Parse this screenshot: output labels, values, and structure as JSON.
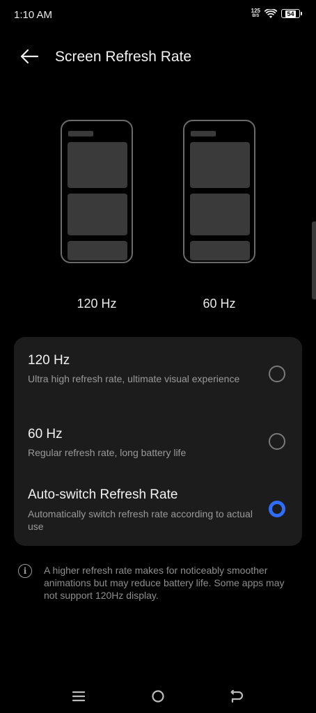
{
  "status_bar": {
    "time": "1:10 AM",
    "net_speed_value": "125",
    "net_speed_unit": "B/S",
    "battery_level": "54"
  },
  "header": {
    "title": "Screen Refresh Rate"
  },
  "preview": {
    "left_caption": "120 Hz",
    "right_caption": "60 Hz"
  },
  "options": [
    {
      "title": "120 Hz",
      "description": "Ultra high refresh rate, ultimate visual experience",
      "selected": false
    },
    {
      "title": "60 Hz",
      "description": "Regular refresh rate, long battery life",
      "selected": false
    },
    {
      "title": "Auto-switch Refresh Rate",
      "description": "Automatically switch refresh rate according to actual use",
      "selected": true
    }
  ],
  "info": {
    "text": "A higher refresh rate makes for noticeably smoother animations but may reduce battery life. Some apps may not support 120Hz display."
  },
  "colors": {
    "accent": "#2f6dfa",
    "card_bg": "#1c1c1c",
    "background": "#000000"
  },
  "icons": {
    "back": "arrow-left-icon",
    "wifi": "wifi-icon",
    "battery": "battery-icon",
    "info": "info-icon",
    "nav_menu": "menu-icon",
    "nav_home": "home-icon",
    "nav_back": "back-icon"
  }
}
